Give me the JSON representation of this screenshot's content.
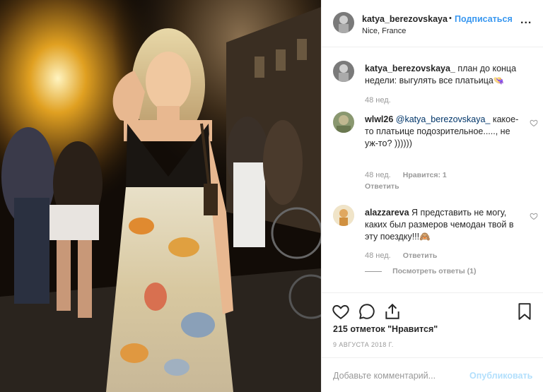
{
  "post": {
    "username": "katya_berezovskaya",
    "separator": "•",
    "follow_label": "Подписаться",
    "location": "Nice, France",
    "more_label": "...",
    "likes_text": "215 отметок \"Нравится\"",
    "date_text": "9 АВГУСТА 2018 Г."
  },
  "caption": {
    "username": "katya_berezovskaya_",
    "text": "план до конца недели: выгулять все платьица👒",
    "time": "48 нед."
  },
  "comments": [
    {
      "username": "wlwl26",
      "mention": "@katya_berezovskaya_",
      "text": "какое-то платьице подозрительное....., не уж-то? ))))))",
      "time": "48 нед.",
      "likes": "Нравится: 1",
      "reply": "Ответить"
    },
    {
      "username": "alazzareva",
      "mention": "",
      "text": "Я представить не могу, каких был размеров чемодан твой в эту поездку!!!🙈",
      "time": "48 нед.",
      "likes": "",
      "reply": "Ответить",
      "view_replies": "Посмотреть ответы (1)"
    }
  ],
  "add_comment": {
    "placeholder": "Добавьте комментарий...",
    "publish_label": "Опубликовать"
  },
  "colors": {
    "accent": "#3897f0",
    "publish_disabled": "#b2dffc",
    "mention": "#003569",
    "secondary_text": "#999999"
  },
  "icons": {
    "like": "heart-icon",
    "comment": "comment-bubble-icon",
    "share": "share-arrow-icon",
    "save": "bookmark-icon",
    "more": "more-dots-icon"
  }
}
